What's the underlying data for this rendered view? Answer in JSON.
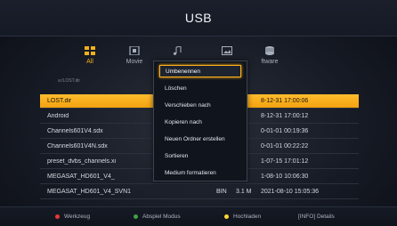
{
  "title": "USB",
  "categories": [
    {
      "label": "All",
      "icon": "grid-icon",
      "active": true
    },
    {
      "label": "Movie",
      "icon": "film-icon",
      "active": false
    },
    {
      "label": "",
      "icon": "music-note-icon",
      "active": false
    },
    {
      "label": "",
      "icon": "image-icon",
      "active": false
    },
    {
      "label": "ftware",
      "icon": "software-icon",
      "active": false
    }
  ],
  "breadcrumb": "a:/LOST.dir",
  "files": [
    {
      "name": "LOST.dir",
      "type": "",
      "size": "",
      "date": "8-12-31 17:00:06"
    },
    {
      "name": "Android",
      "type": "",
      "size": "",
      "date": "8-12-31 17:00:12"
    },
    {
      "name": "Channels601V4.sdx",
      "type": "",
      "size": "",
      "date": "0-01-01 00:19:36"
    },
    {
      "name": "Channels601V4N.sdx",
      "type": "",
      "size": "",
      "date": "0-01-01 00:22:22"
    },
    {
      "name": "preset_dvbs_channels.xi",
      "type": "",
      "size": "",
      "date": "1-07-15 17:01:12"
    },
    {
      "name": "MEGASAT_HD601_V4_",
      "type": "",
      "size": "",
      "date": "1-08-10 10:06:30"
    },
    {
      "name": "MEGASAT_HD601_V4_SVN1",
      "type": "BIN",
      "size": "3.1 M",
      "date": "2021-08-10 15:05:36"
    }
  ],
  "menu": [
    {
      "label": "Umbenennen",
      "selected": true
    },
    {
      "label": "Löschen",
      "selected": false
    },
    {
      "label": "Verschieben nach",
      "selected": false
    },
    {
      "label": "Kopieren nach",
      "selected": false
    },
    {
      "label": "Neuen Ordner erstellen",
      "selected": false
    },
    {
      "label": "Sortieren",
      "selected": false
    },
    {
      "label": "Medium formatieren",
      "selected": false
    }
  ],
  "footer": {
    "red": "Werkzeug",
    "green": "Abspiel Modus",
    "yellow": "Hochladen",
    "info": "[INFO] Details"
  },
  "colors": {
    "accent": "#ffb21a",
    "red": "#e53935",
    "green": "#43a047",
    "yellow": "#fdd835"
  }
}
